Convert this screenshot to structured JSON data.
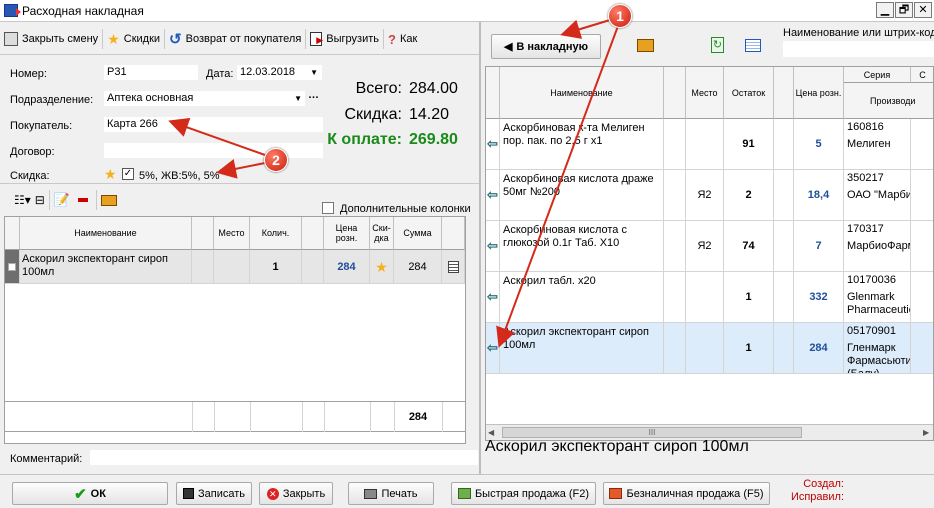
{
  "window": {
    "title": "Расходная накладная",
    "min": "▁",
    "max": "🗗",
    "close": "✕"
  },
  "toolbar": {
    "close_shift": "Закрыть смену",
    "discounts": "Скидки",
    "return_from_buyer": "Возврат от покупателя",
    "upload": "Выгрузить",
    "more": "Как"
  },
  "form": {
    "number_label": "Номер:",
    "number_value": "Р31",
    "date_label": "Дата:",
    "date_value": "12.03.2018",
    "division_label": "Подразделение:",
    "division_value": "Аптека основная",
    "buyer_label": "Покупатель:",
    "buyer_value": "Карта 266",
    "contract_label": "Договор:",
    "contract_value": "",
    "discount_label": "Скидка:",
    "discount_value": "5%, ЖВ:5%, 5%"
  },
  "totals": {
    "total_label": "Всего:",
    "total_value": "284.00",
    "discount_label": "Скидка:",
    "discount_value": "14.20",
    "pay_label": "К оплате:",
    "pay_value": "269.80"
  },
  "invoice_grid": {
    "extra_columns_label": "Дополнительные колонки",
    "headers": {
      "name": "Наименование",
      "place": "Место",
      "qty": "Колич.",
      "price": "Цена розн.",
      "disc": "Ски-дка",
      "sum": "Сумма"
    },
    "rows": [
      {
        "name": "Аскорил экспекторант сироп 100мл",
        "place": "",
        "qty": "1",
        "price": "284",
        "sum": "284"
      }
    ],
    "footer_sum": "284"
  },
  "comment": {
    "label": "Комментарий:",
    "value": ""
  },
  "right_panel": {
    "to_invoice": "В накладную",
    "search_label": "Наименование или штрих-код",
    "headers": {
      "name": "Наименование",
      "place": "Место",
      "stock": "Остаток",
      "price": "Цена розн.",
      "series": "Серия",
      "producer": "Производи",
      "extra": "С"
    },
    "rows": [
      {
        "name": "Аскорбиновая к-та Мелиген пор. пак. по 2,5 г х1",
        "place": "",
        "stock": "91",
        "price": "5",
        "series": "160816",
        "producer": "Мелиген"
      },
      {
        "name": "Аскорбиновая кислота драже 50мг №200",
        "place": "Я2",
        "stock": "2",
        "price": "18,4",
        "series": "350217",
        "producer": "ОАО \"Марбио"
      },
      {
        "name": "Аскорбиновая кислота с глюкозой 0.1г Таб. Х10",
        "place": "Я2",
        "stock": "74",
        "price": "7",
        "series": "170317",
        "producer": "МарбиоФарм"
      },
      {
        "name": "Аскорил табл. х20",
        "place": "",
        "stock": "1",
        "price": "332",
        "series": "10170036",
        "producer": "Glenmark Pharmaceutica"
      },
      {
        "name": "Аскорил экспекторант сироп 100мл",
        "place": "",
        "stock": "1",
        "price": "284",
        "series": "05170901",
        "producer": "Гленмарк Фармасьютик Лтд (Балу)"
      }
    ],
    "selected_name": "Аскорил экспекторант сироп 100мл",
    "scroll_mark": "III"
  },
  "callouts": {
    "one": "1",
    "two": "2"
  },
  "bottom": {
    "ok": "ОК",
    "save": "Записать",
    "close": "Закрыть",
    "print": "Печать",
    "quick_sale": "Быстрая продажа (F2)",
    "cashless_sale": "Безналичная продажа (F5)",
    "created": "Создал:",
    "edited": "Исправил:"
  },
  "colors": {
    "pay_green": "#1a8a1a",
    "price_blue": "#1f4f9a",
    "selected_row": "#dcecfb",
    "annotation_red": "#d42a1a"
  }
}
